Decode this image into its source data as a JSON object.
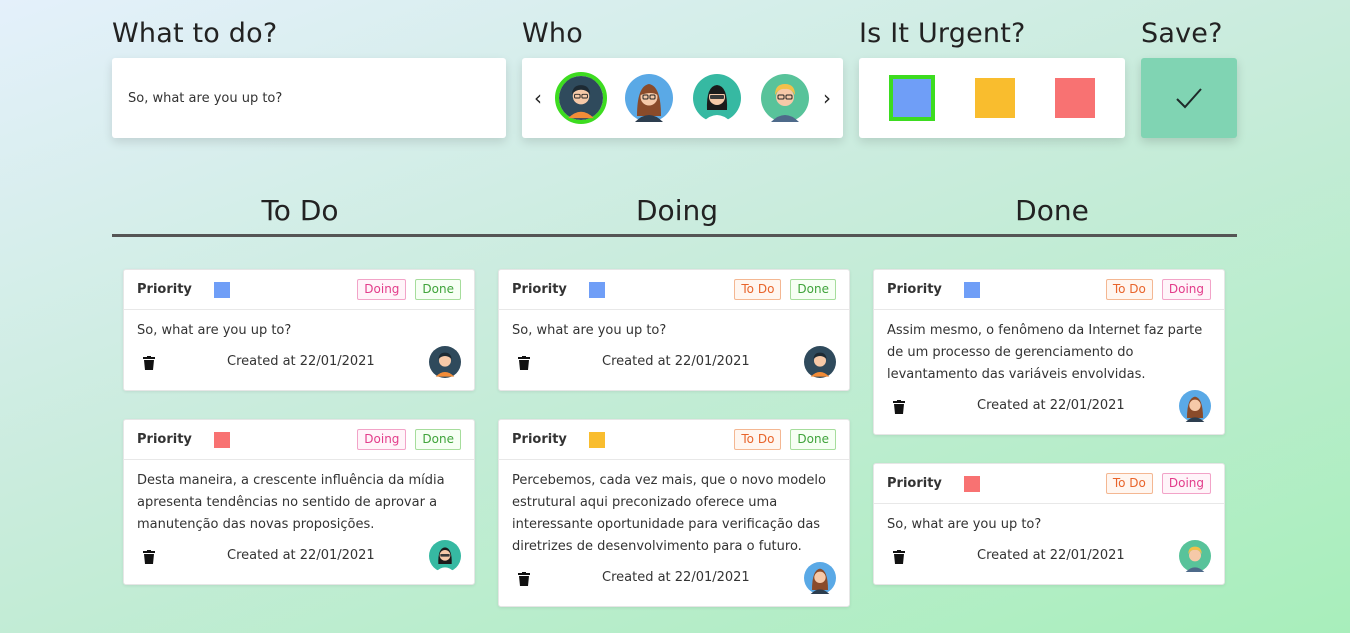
{
  "form": {
    "task_title": "What to do?",
    "task_placeholder": "So, what are you up to?",
    "who_title": "Who",
    "urgent_title": "Is It Urgent?",
    "save_title": "Save?"
  },
  "columns": {
    "todo": "To Do",
    "doing": "Doing",
    "done": "Done"
  },
  "labels": {
    "priority": "Priority",
    "tag_todo": "To Do",
    "tag_doing": "Doing",
    "tag_done": "Done"
  },
  "cards": {
    "todo": [
      {
        "priority_color": "#6f9ef7",
        "text": "So, what are you up to?",
        "created": "Created at 22/01/2021",
        "avatar": "man-dark-hair-icon"
      },
      {
        "priority_color": "#f87272",
        "text": "Desta maneira, a crescente influência da mídia apresenta tendências no sentido de aprovar a manutenção das novas proposições.",
        "created": "Created at 22/01/2021",
        "avatar": "woman-dark-hair-icon"
      }
    ],
    "doing": [
      {
        "priority_color": "#6f9ef7",
        "text": "So, what are you up to?",
        "created": "Created at 22/01/2021",
        "avatar": "man-dark-hair-icon"
      },
      {
        "priority_color": "#f9bd2e",
        "text": "Percebemos, cada vez mais, que o novo modelo estrutural aqui preconizado oferece uma interessante oportunidade para verificação das diretrizes de desenvolvimento para o futuro.",
        "created": "Created at 22/01/2021",
        "avatar": "woman-glasses-icon"
      }
    ],
    "done": [
      {
        "priority_color": "#6f9ef7",
        "text": "Assim mesmo, o fenômeno da Internet faz parte de um processo de gerenciamento do levantamento das variáveis envolvidas.",
        "created": "Created at 22/01/2021",
        "avatar": "woman-glasses-icon"
      },
      {
        "priority_color": "#f87272",
        "text": "So, what are you up to?",
        "created": "Created at 22/01/2021",
        "avatar": "man-blond-glasses-icon"
      }
    ]
  },
  "colors": {
    "blue": "#6f9ef7",
    "yellow": "#f9bd2e",
    "red": "#f87272",
    "selected_border": "#3ddc20",
    "save_button": "#80d4b3"
  }
}
